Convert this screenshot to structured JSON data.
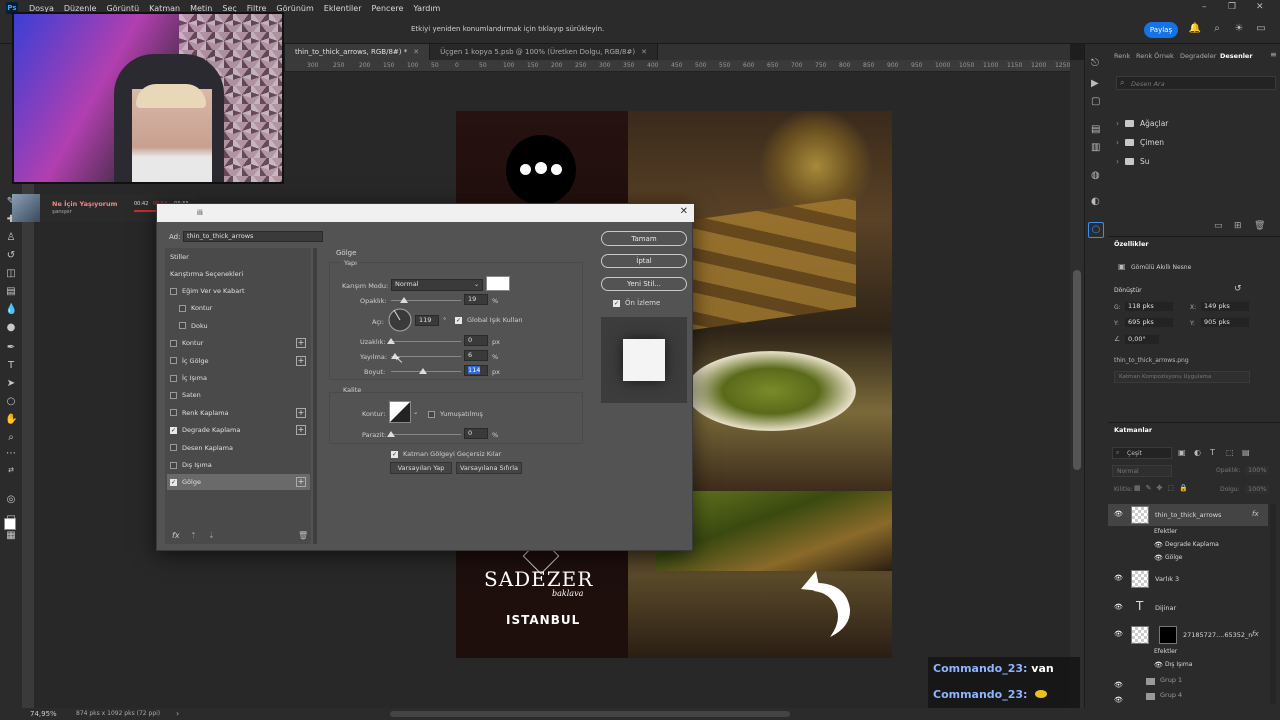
{
  "menubar": {
    "logo": "Ps",
    "items": [
      "Dosya",
      "Düzenle",
      "Görüntü",
      "Katman",
      "Metin",
      "Seç",
      "Filtre",
      "Görünüm",
      "Eklentiler",
      "Pencere",
      "Yardım"
    ]
  },
  "optionsbar": {
    "hint": "Etkiyi yeniden konumlandırmak için tıklayıp sürükleyin.",
    "share_label": "Paylaş"
  },
  "tabs": [
    {
      "label": "thin_to_thick_arrows, RGB/8#) *",
      "active": true
    },
    {
      "label": "Üçgen 1 kopya 5.psb @ 100% (Üretken Dolgu, RGB/8#)",
      "active": false
    }
  ],
  "ruler": [
    "300",
    "250",
    "200",
    "150",
    "100",
    "50",
    "0",
    "50",
    "100",
    "150",
    "200",
    "250",
    "300",
    "350",
    "400",
    "450",
    "500",
    "550",
    "600",
    "650",
    "700",
    "750",
    "800",
    "850",
    "900",
    "950",
    "1000",
    "1050",
    "1100",
    "1150",
    "1200",
    "1250"
  ],
  "music": {
    "title": "Ne İçin Yaşıyorum",
    "artist": "şanışer",
    "time_current": "00:42",
    "time_mid": "00:53",
    "time_total": "03:33",
    "progress": 0.8
  },
  "artwork": {
    "brand": "SADEZER",
    "brand_sub": "baklava",
    "city": "ISTANBUL"
  },
  "dialog": {
    "title_partial": "ili",
    "name_label": "Ad:",
    "name_value": "thin_to_thick_arrows",
    "styles_header": "Stiller",
    "blend_options": "Karıştırma Seçenekleri",
    "style_items": [
      {
        "label": "Eğim Ver ve Kabart",
        "checked": false,
        "plus": false,
        "indent": false
      },
      {
        "label": "Kontur",
        "checked": false,
        "plus": false,
        "indent": true
      },
      {
        "label": "Doku",
        "checked": false,
        "plus": false,
        "indent": true
      },
      {
        "label": "Kontur",
        "checked": false,
        "plus": true,
        "indent": false
      },
      {
        "label": "İç Gölge",
        "checked": false,
        "plus": true,
        "indent": false
      },
      {
        "label": "İç Işıma",
        "checked": false,
        "plus": false,
        "indent": false
      },
      {
        "label": "Saten",
        "checked": false,
        "plus": false,
        "indent": false
      },
      {
        "label": "Renk Kaplama",
        "checked": false,
        "plus": true,
        "indent": false
      },
      {
        "label": "Degrade Kaplama",
        "checked": true,
        "plus": true,
        "indent": false
      },
      {
        "label": "Desen Kaplama",
        "checked": false,
        "plus": false,
        "indent": false
      },
      {
        "label": "Dış Işıma",
        "checked": false,
        "plus": false,
        "indent": false
      },
      {
        "label": "Gölge",
        "checked": true,
        "plus": true,
        "indent": false,
        "selected": true
      }
    ],
    "fx_label": "fx",
    "section_title": "Gölge",
    "structure_title": "Yapı",
    "blend_mode_label": "Karışım Modu:",
    "blend_mode_value": "Normal",
    "opacity_label": "Opaklık:",
    "opacity_value": "19",
    "opacity_unit": "%",
    "opacity_level": 19,
    "angle_label": "Açı:",
    "angle_value": "119",
    "angle_unit": "°",
    "global_light_label": "Global Işık Kullan",
    "distance_label": "Uzaklık:",
    "distance_value": "0",
    "distance_unit": "px",
    "spread_label": "Yayılma:",
    "spread_value": "6",
    "spread_unit": "%",
    "size_label": "Boyut:",
    "size_value": "114",
    "size_unit": "px",
    "quality_title": "Kalite",
    "contour_label": "Kontur:",
    "anti_alias_label": "Yumuşatılmış",
    "noise_label": "Parazit:",
    "noise_value": "0",
    "noise_unit": "%",
    "knockout_label": "Katman Gölgeyi Geçersiz Kılar",
    "make_default": "Varsayılan Yap",
    "reset_default": "Varsayılana Sıfırla",
    "ok_label": "Tamam",
    "cancel_label": "İptal",
    "new_style_label": "Yeni Stil...",
    "preview_label": "Ön İzleme"
  },
  "right_panel": {
    "tabs": [
      "Renk",
      "Renk Örnek",
      "Degradeler",
      "Desenler"
    ],
    "search_placeholder": "Desen Ara",
    "folders": [
      "Ağaçlar",
      "Çimen",
      "Su"
    ],
    "properties_title": "Özellikler",
    "smart_object": "Gömülü Akıllı Nesne",
    "transform_title": "Dönüştür",
    "w_label": "G:",
    "w_value": "118 pks",
    "x_label": "X:",
    "x_value": "149 pks",
    "h_label": "Y:",
    "h_value": "695 pks",
    "y_label": "Y:",
    "y_value": "905 pks",
    "angle_value": "0,00°",
    "file_name": "thin_to_thick_arrows.png",
    "comp_placeholder": "Katman Kompozisyonu Uygulama",
    "layers_title": "Katmanlar",
    "layer_filter": "Çeşit",
    "blend_value": "Normal",
    "opacity_label": "Opaklık:",
    "opacity_value": "100%",
    "lock_label": "Kilitle:",
    "fill_label": "Dolgu:",
    "fill_value": "100%",
    "layers": [
      {
        "name": "thin_to_thick_arrows",
        "type": "smart",
        "fx": true
      },
      {
        "name": "Efektler",
        "type": "effects"
      },
      {
        "name": "Degrade Kaplama",
        "type": "effect"
      },
      {
        "name": "Gölge",
        "type": "effect"
      },
      {
        "name": "Varlık 3",
        "type": "smart"
      },
      {
        "name": "Dijinar",
        "type": "text"
      },
      {
        "name": "27185727....65352_n",
        "type": "masked",
        "fx": true
      },
      {
        "name": "Efektler",
        "type": "effects"
      },
      {
        "name": "Dış Işıma",
        "type": "effect"
      },
      {
        "name": "Grup 1",
        "type": "group"
      },
      {
        "name": "Grup 4",
        "type": "group"
      }
    ]
  },
  "chat": [
    {
      "user": "Commando_23:",
      "message": "van"
    },
    {
      "user": "Commando_23:",
      "message": ""
    }
  ],
  "status": {
    "zoom": "74,95%",
    "doc_size": "874 pks x 1092 pks (72 ppi)"
  }
}
